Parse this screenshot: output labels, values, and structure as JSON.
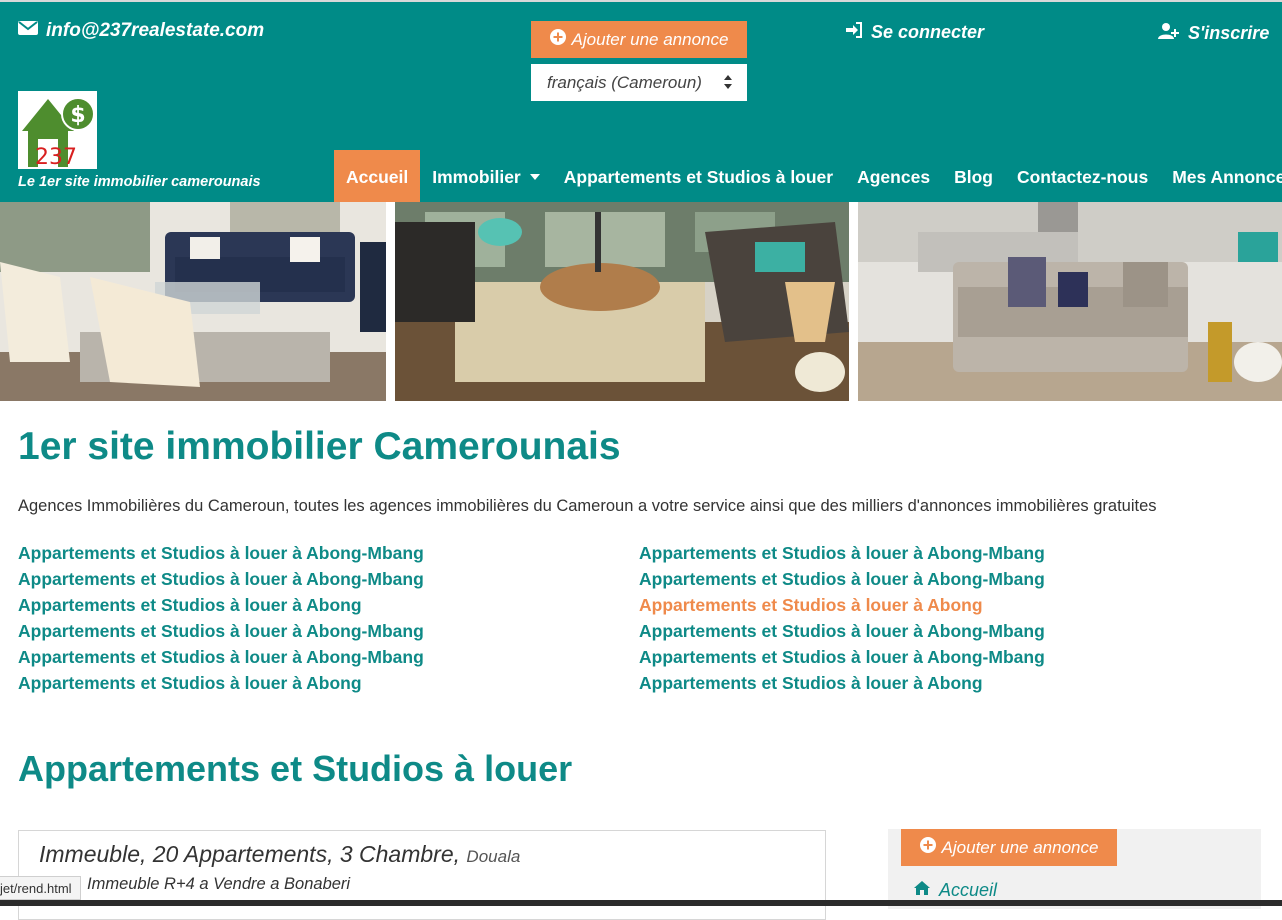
{
  "header": {
    "email": "info@237realestate.com",
    "add_listing": "Ajouter une annonce",
    "language": "français (Cameroun)",
    "login": "Se connecter",
    "signup": "S'inscrire",
    "logo_text": "237",
    "tagline": "Le 1er site immobilier camerounais"
  },
  "nav": {
    "items": [
      {
        "label": "Accueil",
        "active": true
      },
      {
        "label": "Immobilier",
        "dropdown": true
      },
      {
        "label": "Appartements et Studios à louer"
      },
      {
        "label": "Agences"
      },
      {
        "label": "Blog"
      },
      {
        "label": "Contactez-nous"
      },
      {
        "label": "Mes Annonces"
      }
    ]
  },
  "main": {
    "title": "1er site immobilier Camerounais",
    "intro": "Agences Immobilières du Cameroun, toutes les agences immobilières du Cameroun a votre service ainsi que des milliers d'annonces immobilières gratuites",
    "links_left": [
      "Appartements et Studios à louer à Abong-Mbang",
      "Appartements et Studios à louer à Abong-Mbang",
      "Appartements et Studios à louer à Abong",
      "Appartements et Studios à louer à Abong-Mbang",
      "Appartements et Studios à louer à Abong-Mbang",
      "Appartements et Studios à louer à Abong"
    ],
    "links_right": [
      "Appartements et Studios à louer à Abong-Mbang",
      "Appartements et Studios à louer à Abong-Mbang",
      "Appartements et Studios à louer à Abong",
      "Appartements et Studios à louer à Abong-Mbang",
      "Appartements et Studios à louer à Abong-Mbang",
      "Appartements et Studios à louer à Abong"
    ],
    "highlighted_right_index": 2,
    "section_title": "Appartements et Studios à louer"
  },
  "listing": {
    "title": "Immeuble, 20 Appartements, 3 Chambre,",
    "city": "Douala",
    "subtitle": "Immeuble R+4 a Vendre a Bonaberi"
  },
  "sidebar": {
    "add_listing": "Ajouter une annonce",
    "home": "Accueil"
  },
  "status_url": "jet/rend.html",
  "colors": {
    "header_bg": "#008b87",
    "accent": "#ef8a4b",
    "link": "#0e8a87"
  }
}
